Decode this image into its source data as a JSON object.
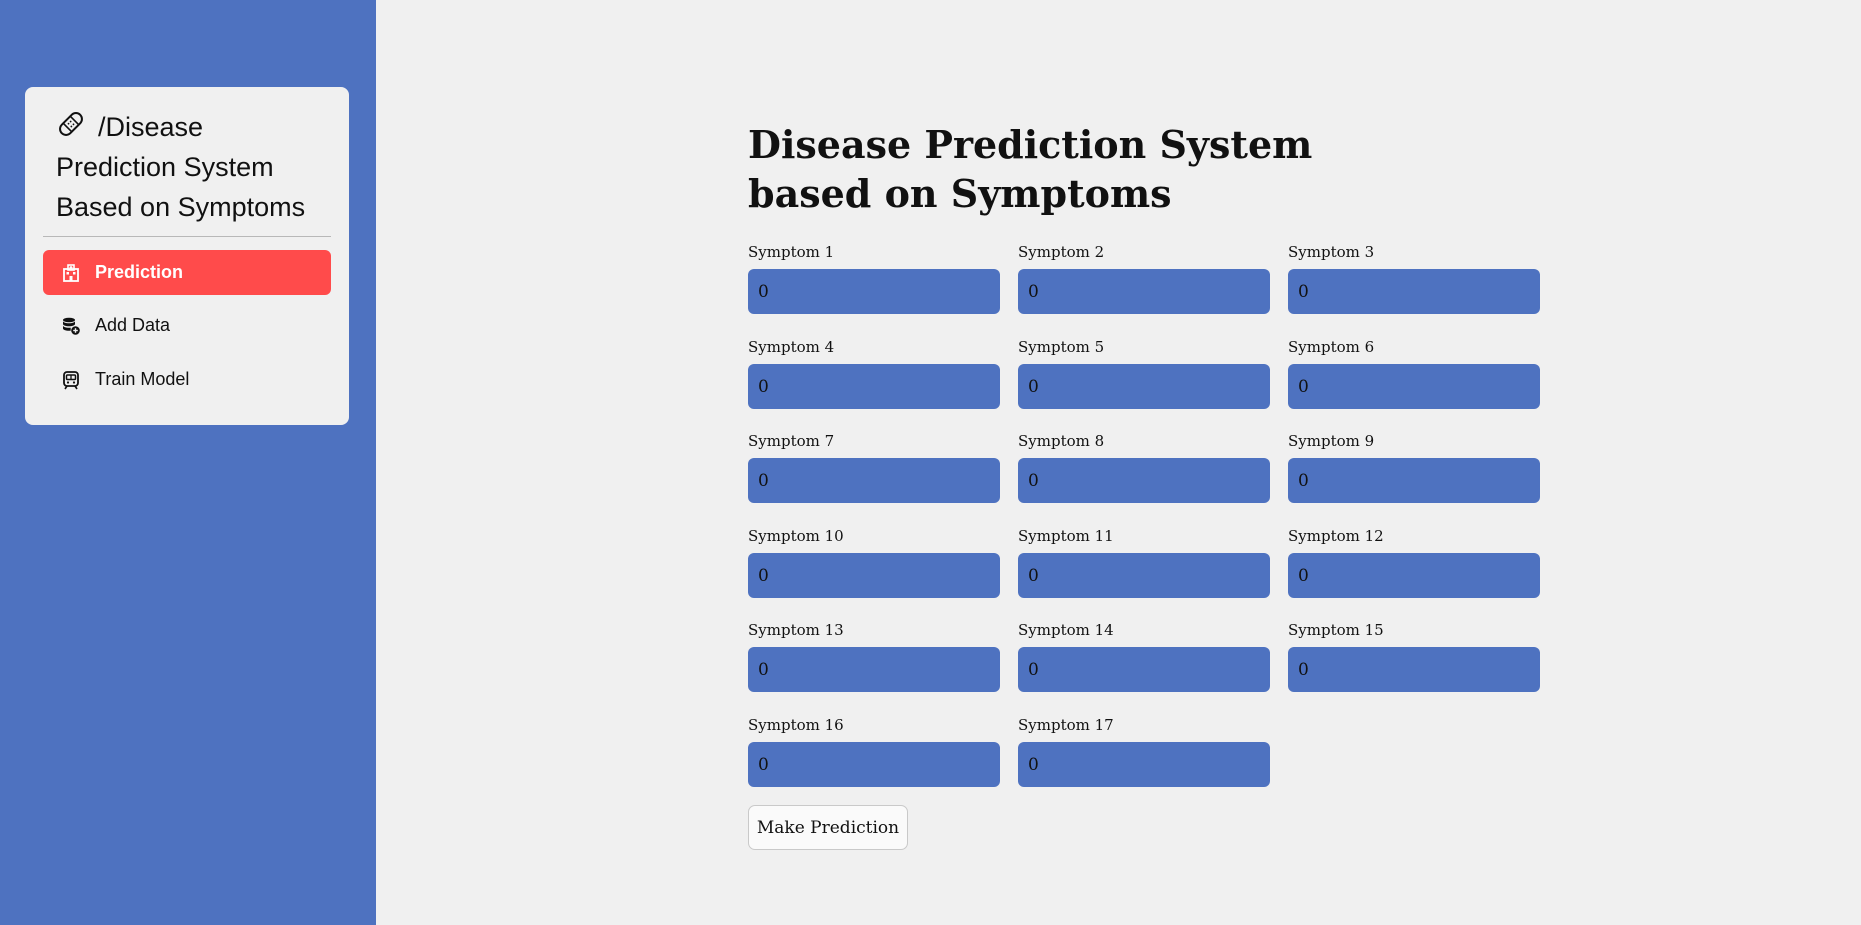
{
  "sidebar": {
    "title": "/Disease Prediction System Based on Symptoms",
    "items": [
      {
        "label": "Prediction",
        "icon": "hospital-icon",
        "active": true
      },
      {
        "label": "Add Data",
        "icon": "database-add-icon",
        "active": false
      },
      {
        "label": "Train Model",
        "icon": "train-icon",
        "active": false
      }
    ]
  },
  "main": {
    "title": "Disease Prediction System based on Symptoms",
    "symptoms": [
      {
        "label": "Symptom 1",
        "value": "0"
      },
      {
        "label": "Symptom 2",
        "value": "0"
      },
      {
        "label": "Symptom 3",
        "value": "0"
      },
      {
        "label": "Symptom 4",
        "value": "0"
      },
      {
        "label": "Symptom 5",
        "value": "0"
      },
      {
        "label": "Symptom 6",
        "value": "0"
      },
      {
        "label": "Symptom 7",
        "value": "0"
      },
      {
        "label": "Symptom 8",
        "value": "0"
      },
      {
        "label": "Symptom 9",
        "value": "0"
      },
      {
        "label": "Symptom 10",
        "value": "0"
      },
      {
        "label": "Symptom 11",
        "value": "0"
      },
      {
        "label": "Symptom 12",
        "value": "0"
      },
      {
        "label": "Symptom 13",
        "value": "0"
      },
      {
        "label": "Symptom 14",
        "value": "0"
      },
      {
        "label": "Symptom 15",
        "value": "0"
      },
      {
        "label": "Symptom 16",
        "value": "0"
      },
      {
        "label": "Symptom 17",
        "value": "0"
      }
    ],
    "predict_button": "Make Prediction"
  },
  "colors": {
    "sidebar_bg": "#4e72c0",
    "active_item": "#ff4b4b",
    "input_bg": "#4e72c0",
    "page_bg": "#f0f0f0"
  }
}
